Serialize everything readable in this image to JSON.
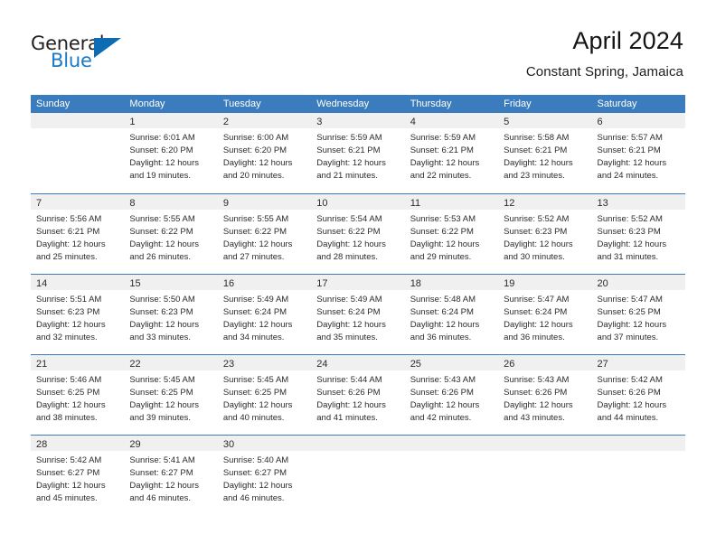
{
  "logo": {
    "word_one": "General",
    "word_two": "Blue",
    "triangle_color": "#0d6cb4",
    "text_color": "#231f20",
    "blue_text_color": "#1a7ac7"
  },
  "header": {
    "title": "April 2024",
    "subtitle": "Constant Spring, Jamaica"
  },
  "theme": {
    "header_blue": "#3a7cbe",
    "day_band_gray": "#f0f0f0",
    "text": "#2b2b2b"
  },
  "weekdays": [
    "Sunday",
    "Monday",
    "Tuesday",
    "Wednesday",
    "Thursday",
    "Friday",
    "Saturday"
  ],
  "weeks": [
    {
      "days": [
        {
          "num": "",
          "lines": []
        },
        {
          "num": "1",
          "lines": [
            "Sunrise: 6:01 AM",
            "Sunset: 6:20 PM",
            "Daylight: 12 hours",
            "and 19 minutes."
          ]
        },
        {
          "num": "2",
          "lines": [
            "Sunrise: 6:00 AM",
            "Sunset: 6:20 PM",
            "Daylight: 12 hours",
            "and 20 minutes."
          ]
        },
        {
          "num": "3",
          "lines": [
            "Sunrise: 5:59 AM",
            "Sunset: 6:21 PM",
            "Daylight: 12 hours",
            "and 21 minutes."
          ]
        },
        {
          "num": "4",
          "lines": [
            "Sunrise: 5:59 AM",
            "Sunset: 6:21 PM",
            "Daylight: 12 hours",
            "and 22 minutes."
          ]
        },
        {
          "num": "5",
          "lines": [
            "Sunrise: 5:58 AM",
            "Sunset: 6:21 PM",
            "Daylight: 12 hours",
            "and 23 minutes."
          ]
        },
        {
          "num": "6",
          "lines": [
            "Sunrise: 5:57 AM",
            "Sunset: 6:21 PM",
            "Daylight: 12 hours",
            "and 24 minutes."
          ]
        }
      ]
    },
    {
      "days": [
        {
          "num": "7",
          "lines": [
            "Sunrise: 5:56 AM",
            "Sunset: 6:21 PM",
            "Daylight: 12 hours",
            "and 25 minutes."
          ]
        },
        {
          "num": "8",
          "lines": [
            "Sunrise: 5:55 AM",
            "Sunset: 6:22 PM",
            "Daylight: 12 hours",
            "and 26 minutes."
          ]
        },
        {
          "num": "9",
          "lines": [
            "Sunrise: 5:55 AM",
            "Sunset: 6:22 PM",
            "Daylight: 12 hours",
            "and 27 minutes."
          ]
        },
        {
          "num": "10",
          "lines": [
            "Sunrise: 5:54 AM",
            "Sunset: 6:22 PM",
            "Daylight: 12 hours",
            "and 28 minutes."
          ]
        },
        {
          "num": "11",
          "lines": [
            "Sunrise: 5:53 AM",
            "Sunset: 6:22 PM",
            "Daylight: 12 hours",
            "and 29 minutes."
          ]
        },
        {
          "num": "12",
          "lines": [
            "Sunrise: 5:52 AM",
            "Sunset: 6:23 PM",
            "Daylight: 12 hours",
            "and 30 minutes."
          ]
        },
        {
          "num": "13",
          "lines": [
            "Sunrise: 5:52 AM",
            "Sunset: 6:23 PM",
            "Daylight: 12 hours",
            "and 31 minutes."
          ]
        }
      ]
    },
    {
      "days": [
        {
          "num": "14",
          "lines": [
            "Sunrise: 5:51 AM",
            "Sunset: 6:23 PM",
            "Daylight: 12 hours",
            "and 32 minutes."
          ]
        },
        {
          "num": "15",
          "lines": [
            "Sunrise: 5:50 AM",
            "Sunset: 6:23 PM",
            "Daylight: 12 hours",
            "and 33 minutes."
          ]
        },
        {
          "num": "16",
          "lines": [
            "Sunrise: 5:49 AM",
            "Sunset: 6:24 PM",
            "Daylight: 12 hours",
            "and 34 minutes."
          ]
        },
        {
          "num": "17",
          "lines": [
            "Sunrise: 5:49 AM",
            "Sunset: 6:24 PM",
            "Daylight: 12 hours",
            "and 35 minutes."
          ]
        },
        {
          "num": "18",
          "lines": [
            "Sunrise: 5:48 AM",
            "Sunset: 6:24 PM",
            "Daylight: 12 hours",
            "and 36 minutes."
          ]
        },
        {
          "num": "19",
          "lines": [
            "Sunrise: 5:47 AM",
            "Sunset: 6:24 PM",
            "Daylight: 12 hours",
            "and 36 minutes."
          ]
        },
        {
          "num": "20",
          "lines": [
            "Sunrise: 5:47 AM",
            "Sunset: 6:25 PM",
            "Daylight: 12 hours",
            "and 37 minutes."
          ]
        }
      ]
    },
    {
      "days": [
        {
          "num": "21",
          "lines": [
            "Sunrise: 5:46 AM",
            "Sunset: 6:25 PM",
            "Daylight: 12 hours",
            "and 38 minutes."
          ]
        },
        {
          "num": "22",
          "lines": [
            "Sunrise: 5:45 AM",
            "Sunset: 6:25 PM",
            "Daylight: 12 hours",
            "and 39 minutes."
          ]
        },
        {
          "num": "23",
          "lines": [
            "Sunrise: 5:45 AM",
            "Sunset: 6:25 PM",
            "Daylight: 12 hours",
            "and 40 minutes."
          ]
        },
        {
          "num": "24",
          "lines": [
            "Sunrise: 5:44 AM",
            "Sunset: 6:26 PM",
            "Daylight: 12 hours",
            "and 41 minutes."
          ]
        },
        {
          "num": "25",
          "lines": [
            "Sunrise: 5:43 AM",
            "Sunset: 6:26 PM",
            "Daylight: 12 hours",
            "and 42 minutes."
          ]
        },
        {
          "num": "26",
          "lines": [
            "Sunrise: 5:43 AM",
            "Sunset: 6:26 PM",
            "Daylight: 12 hours",
            "and 43 minutes."
          ]
        },
        {
          "num": "27",
          "lines": [
            "Sunrise: 5:42 AM",
            "Sunset: 6:26 PM",
            "Daylight: 12 hours",
            "and 44 minutes."
          ]
        }
      ]
    },
    {
      "days": [
        {
          "num": "28",
          "lines": [
            "Sunrise: 5:42 AM",
            "Sunset: 6:27 PM",
            "Daylight: 12 hours",
            "and 45 minutes."
          ]
        },
        {
          "num": "29",
          "lines": [
            "Sunrise: 5:41 AM",
            "Sunset: 6:27 PM",
            "Daylight: 12 hours",
            "and 46 minutes."
          ]
        },
        {
          "num": "30",
          "lines": [
            "Sunrise: 5:40 AM",
            "Sunset: 6:27 PM",
            "Daylight: 12 hours",
            "and 46 minutes."
          ]
        },
        {
          "num": "",
          "lines": []
        },
        {
          "num": "",
          "lines": []
        },
        {
          "num": "",
          "lines": []
        },
        {
          "num": "",
          "lines": []
        }
      ]
    }
  ]
}
